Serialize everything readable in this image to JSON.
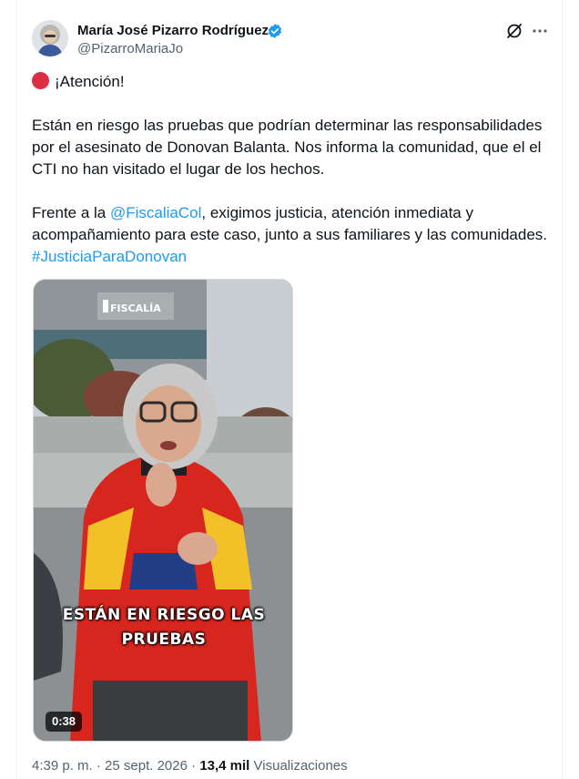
{
  "author": {
    "display_name": "María José Pizarro Rodríguez",
    "handle": "@PizarroMariaJo",
    "verified": true
  },
  "tweet": {
    "line_attention": "¡Atención!",
    "paragraph1": "Están en riesgo las pruebas que podrían determinar las responsabilidades por el asesinato de Donovan Balanta. Nos informa la comunidad, que el el CTI no han visitado el lugar de los hechos.",
    "p2_before": "Frente a la ",
    "mention": "@FiscaliaCol",
    "p2_after": ", exigimos justicia, atención inmediata y acompañamiento para este caso, junto a sus familiares y las comunidades. ",
    "hashtag": "#JusticiaParaDonovan"
  },
  "media": {
    "building_sign": "FISCALÍA",
    "caption_line1": "ESTÁN EN RIESGO LAS",
    "caption_line2": "PRUEBAS",
    "duration": "0:38"
  },
  "meta": {
    "time": "4:39 p. m.",
    "separator": "·",
    "date": "25 sept. 2026",
    "views_count": "13,4 mil",
    "views_label": "Visualizaciones"
  },
  "icons": {
    "grok": "grok-icon",
    "more": "more-icon",
    "verified": "verified-badge-icon",
    "emoji": "red-circle-icon"
  },
  "colors": {
    "link": "#1d9bf0",
    "verified": "#1d9bf0",
    "secondary_text": "#536471",
    "emoji_red": "#dd2e44"
  }
}
